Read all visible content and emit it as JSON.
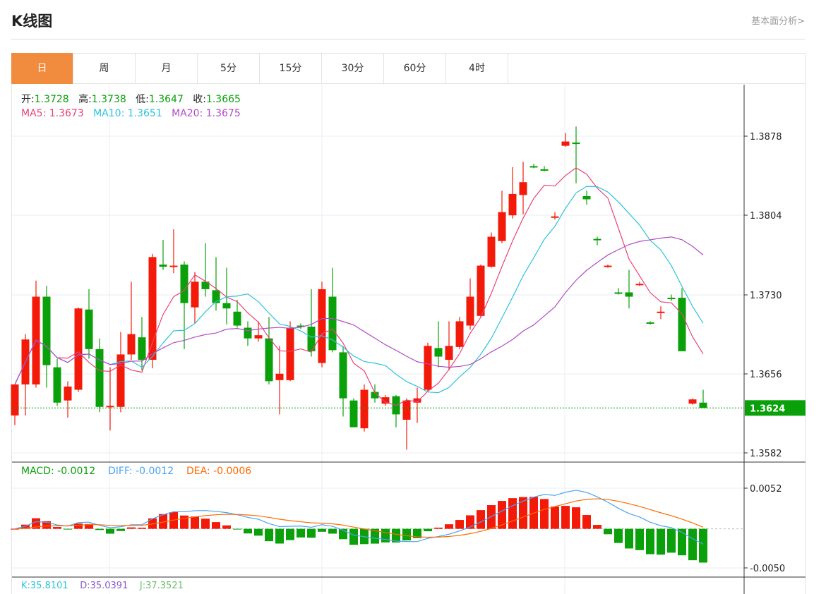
{
  "header": {
    "title": "K线图",
    "link": "基本面分析>"
  },
  "tabs": [
    {
      "label": "日",
      "active": true
    },
    {
      "label": "周"
    },
    {
      "label": "月"
    },
    {
      "label": "5分"
    },
    {
      "label": "15分"
    },
    {
      "label": "30分"
    },
    {
      "label": "60分"
    },
    {
      "label": "4时"
    }
  ],
  "ohlc": {
    "open_label": "开:",
    "open": "1.3728",
    "high_label": "高:",
    "high": "1.3738",
    "low_label": "低:",
    "low": "1.3647",
    "close_label": "收:",
    "close": "1.3665"
  },
  "ma": {
    "ma5_label": "MA5:",
    "ma5": "1.3673",
    "ma10_label": "MA10:",
    "ma10": "1.3651",
    "ma20_label": "MA20:",
    "ma20": "1.3675"
  },
  "macd": {
    "macd_label": "MACD:",
    "macd": "-0.0012",
    "diff_label": "DIFF:",
    "diff": "-0.0012",
    "dea_label": "DEA:",
    "dea": "-0.0006"
  },
  "kdj": {
    "k_label": "K:",
    "k": "35.8101",
    "d_label": "D:",
    "d": "35.0391",
    "j_label": "J:",
    "j": "37.3521"
  },
  "colors": {
    "up": "#f31a0a",
    "down": "#0aa00a",
    "ma5": "#e8437b",
    "ma10": "#2ec3d9",
    "ma20": "#b14cc2",
    "diff": "#49a3f0",
    "dea": "#ff6a00",
    "accent": "#f18b3e"
  },
  "chart_data": {
    "type": "candlestick",
    "price_axis": {
      "ticks": [
        "1.3878",
        "1.3804",
        "1.3730",
        "1.3656",
        "1.3582"
      ],
      "range": [
        1.3582,
        1.3878
      ]
    },
    "current_price": "1.3624",
    "macd_axis": {
      "ticks": [
        "0.0052",
        "-0.0050"
      ],
      "range": [
        -0.005,
        0.0052
      ]
    },
    "candles": [
      [
        1.3617,
        1.3646,
        1.3646,
        1.3608
      ],
      [
        1.3646,
        1.3688,
        1.3693,
        1.3617
      ],
      [
        1.3646,
        1.3728,
        1.3743,
        1.3643
      ],
      [
        1.3728,
        1.3664,
        1.3738,
        1.3643
      ],
      [
        1.3662,
        1.3629,
        1.367,
        1.3626
      ],
      [
        1.3631,
        1.3644,
        1.3649,
        1.3615
      ],
      [
        1.3641,
        1.3717,
        1.3718,
        1.3639
      ],
      [
        1.3716,
        1.3679,
        1.3735,
        1.367
      ],
      [
        1.3679,
        1.3625,
        1.3689,
        1.362
      ],
      [
        1.3625,
        1.3626,
        1.3662,
        1.3603
      ],
      [
        1.3625,
        1.3674,
        1.3695,
        1.362
      ],
      [
        1.3674,
        1.3693,
        1.3742,
        1.3669
      ],
      [
        1.369,
        1.3669,
        1.3709,
        1.3659
      ],
      [
        1.3669,
        1.3765,
        1.3768,
        1.3661
      ],
      [
        1.3758,
        1.3756,
        1.3781,
        1.3753
      ],
      [
        1.3757,
        1.3757,
        1.3791,
        1.375
      ],
      [
        1.3758,
        1.3722,
        1.3761,
        1.3679
      ],
      [
        1.3718,
        1.3742,
        1.3751,
        1.3703
      ],
      [
        1.3742,
        1.3735,
        1.3778,
        1.3728
      ],
      [
        1.3734,
        1.3722,
        1.3765,
        1.3715
      ],
      [
        1.3722,
        1.3717,
        1.3755,
        1.3702
      ],
      [
        1.3714,
        1.3701,
        1.3725,
        1.3699
      ],
      [
        1.3699,
        1.3689,
        1.3705,
        1.3682
      ],
      [
        1.3689,
        1.3692,
        1.3705,
        1.3686
      ],
      [
        1.3689,
        1.3649,
        1.3709,
        1.3646
      ],
      [
        1.365,
        1.3656,
        1.3682,
        1.3618
      ],
      [
        1.365,
        1.3699,
        1.3705,
        1.3649
      ],
      [
        1.3701,
        1.37,
        1.3703,
        1.3698
      ],
      [
        1.37,
        1.3677,
        1.3735,
        1.3672
      ],
      [
        1.3666,
        1.3735,
        1.3742,
        1.3662
      ],
      [
        1.3728,
        1.3678,
        1.3755,
        1.3676
      ],
      [
        1.3676,
        1.3633,
        1.3682,
        1.3616
      ],
      [
        1.3631,
        1.3606,
        1.3633,
        1.3606
      ],
      [
        1.3605,
        1.3641,
        1.3646,
        1.3602
      ],
      [
        1.3639,
        1.3633,
        1.3646,
        1.3629
      ],
      [
        1.3628,
        1.3634,
        1.3636,
        1.3626
      ],
      [
        1.3635,
        1.3618,
        1.3636,
        1.3606
      ],
      [
        1.3613,
        1.3631,
        1.3633,
        1.3585
      ],
      [
        1.3629,
        1.3633,
        1.3643,
        1.361
      ],
      [
        1.3641,
        1.3682,
        1.3685,
        1.3639
      ],
      [
        1.368,
        1.3672,
        1.3705,
        1.3662
      ],
      [
        1.3669,
        1.3682,
        1.3705,
        1.3659
      ],
      [
        1.3681,
        1.3705,
        1.3709,
        1.3679
      ],
      [
        1.3701,
        1.3728,
        1.3745,
        1.3697
      ],
      [
        1.371,
        1.3757,
        1.3758,
        1.3709
      ],
      [
        1.3756,
        1.3784,
        1.3788,
        1.3755
      ],
      [
        1.378,
        1.3807,
        1.3827,
        1.3778
      ],
      [
        1.3804,
        1.3824,
        1.3849,
        1.3801
      ],
      [
        1.3823,
        1.3835,
        1.3854,
        1.3805
      ],
      [
        1.385,
        1.3849,
        1.3852,
        1.3848
      ],
      [
        1.3847,
        1.3846,
        1.385,
        1.3845
      ],
      [
        1.3802,
        1.3803,
        1.3807,
        1.38
      ],
      [
        1.3869,
        1.3873,
        1.3881,
        1.3868
      ],
      [
        1.3872,
        1.3871,
        1.3887,
        1.3834
      ],
      [
        1.3822,
        1.3819,
        1.3827,
        1.3814
      ],
      [
        1.3782,
        1.3781,
        1.3784,
        1.3776
      ],
      [
        1.3756,
        1.3757,
        1.3758,
        1.3755
      ],
      [
        1.3732,
        1.3731,
        1.3736,
        1.373
      ],
      [
        1.3732,
        1.3728,
        1.3753,
        1.3717
      ],
      [
        1.3739,
        1.374,
        1.3742,
        1.3738
      ],
      [
        1.3704,
        1.3703,
        1.3705,
        1.3702
      ],
      [
        1.3713,
        1.3714,
        1.3719,
        1.3707
      ],
      [
        1.3727,
        1.3726,
        1.373,
        1.3724
      ],
      [
        1.3727,
        1.3677,
        1.3736,
        1.3677
      ],
      [
        1.3628,
        1.3632,
        1.3633,
        1.3627
      ],
      [
        1.3629,
        1.3624,
        1.3641,
        1.3624
      ]
    ]
  }
}
